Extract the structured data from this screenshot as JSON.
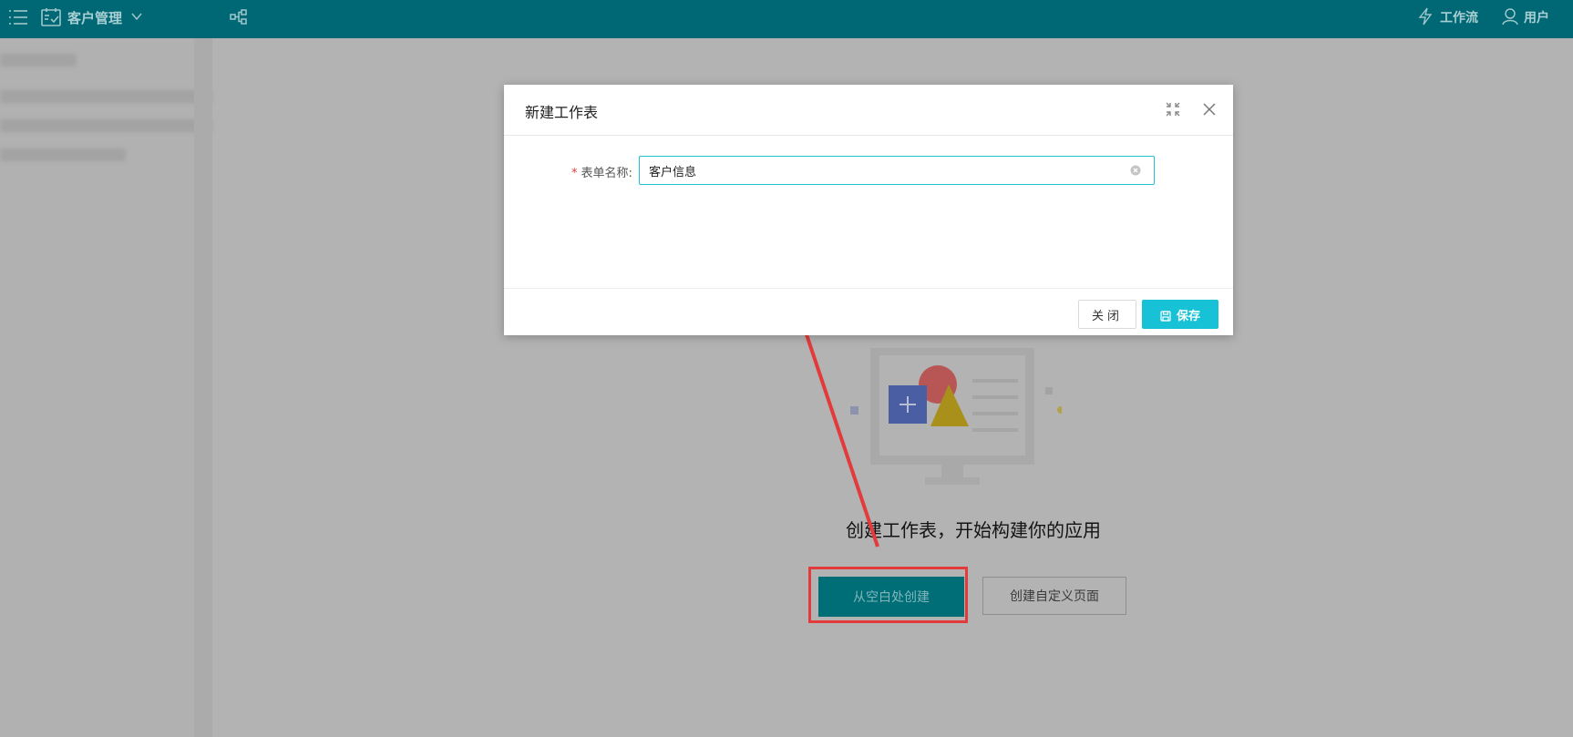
{
  "topbar": {
    "app_name": "客户管理",
    "workflow_label": "工作流",
    "users_label": "用户",
    "icons": [
      "list-icon",
      "calendar-icon",
      "chevron-down-icon",
      "hierarchy-icon",
      "lightning-icon",
      "user-icon"
    ]
  },
  "empty_state": {
    "title": "创建工作表，开始构建你的应用",
    "create_blank_label": "从空白处创建",
    "create_custom_page_label": "创建自定义页面"
  },
  "modal": {
    "title": "新建工作表",
    "field_label": "表单名称:",
    "field_required_mark": "*",
    "field_value": "客户信息",
    "close_label": "关闭",
    "save_label": "保存"
  },
  "colors": {
    "topbar": "#006874",
    "accent": "#17c2d6",
    "highlight": "#e33b3b"
  }
}
